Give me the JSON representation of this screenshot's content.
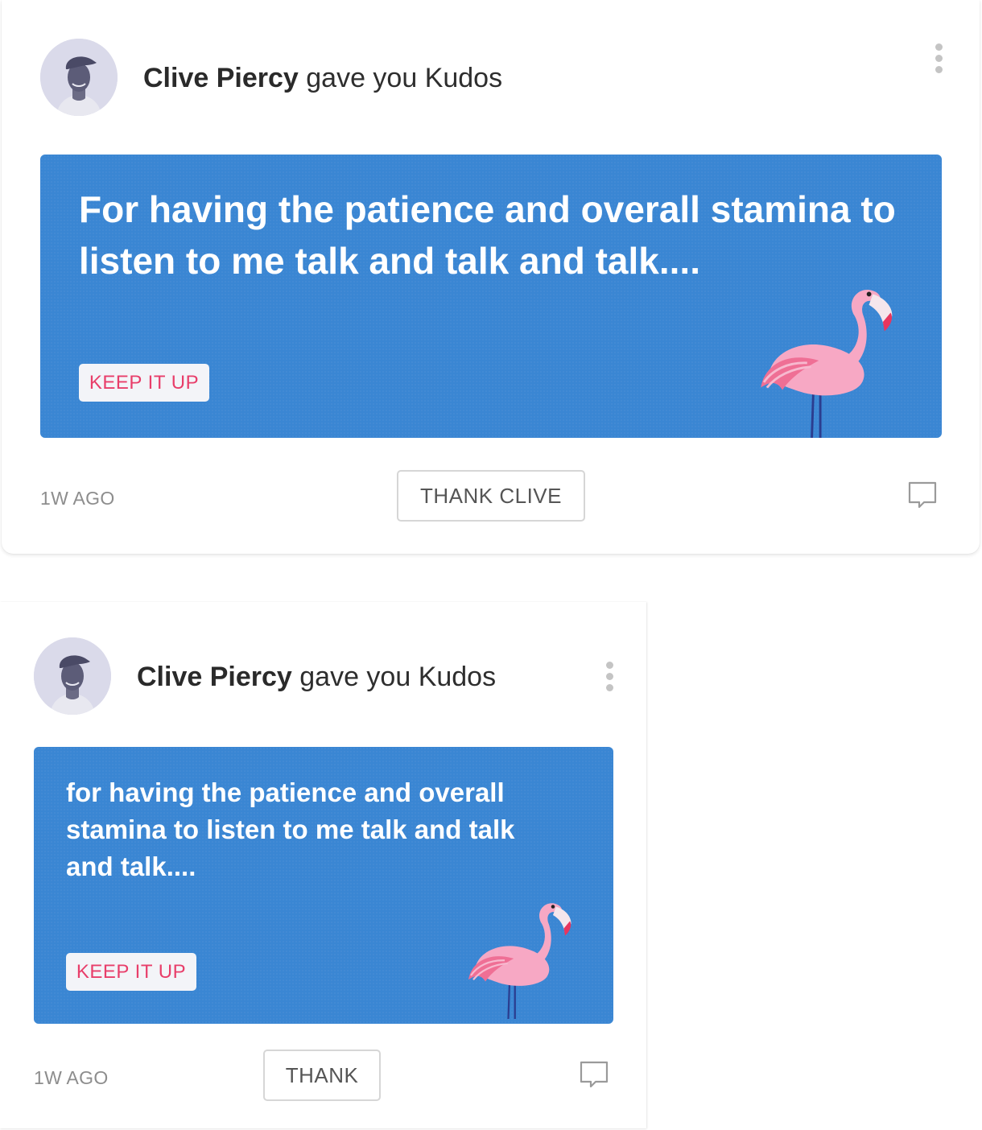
{
  "posts": [
    {
      "author": "Clive Piercy",
      "action": "gave you Kudos",
      "message": "For having the patience and overall stamina to listen to me talk and talk and talk....",
      "tag": "KEEP IT UP",
      "time": "1W AGO",
      "thank_label": "THANK CLIVE",
      "icons": {
        "menu": "kebab-menu-icon",
        "comment": "comment-icon",
        "illustration": "flamingo-icon"
      }
    },
    {
      "author": "Clive Piercy",
      "action": "gave you Kudos",
      "message": "for having the patience and overall stamina to listen to me talk and talk and talk....",
      "tag": "KEEP IT UP",
      "time": "1W AGO",
      "thank_label": "THANK",
      "icons": {
        "menu": "kebab-menu-icon",
        "comment": "comment-icon",
        "illustration": "flamingo-icon"
      }
    }
  ],
  "colors": {
    "banner": "#3a86d3",
    "tag_text": "#e83e6a",
    "flamingo": "#f7a8c4"
  }
}
